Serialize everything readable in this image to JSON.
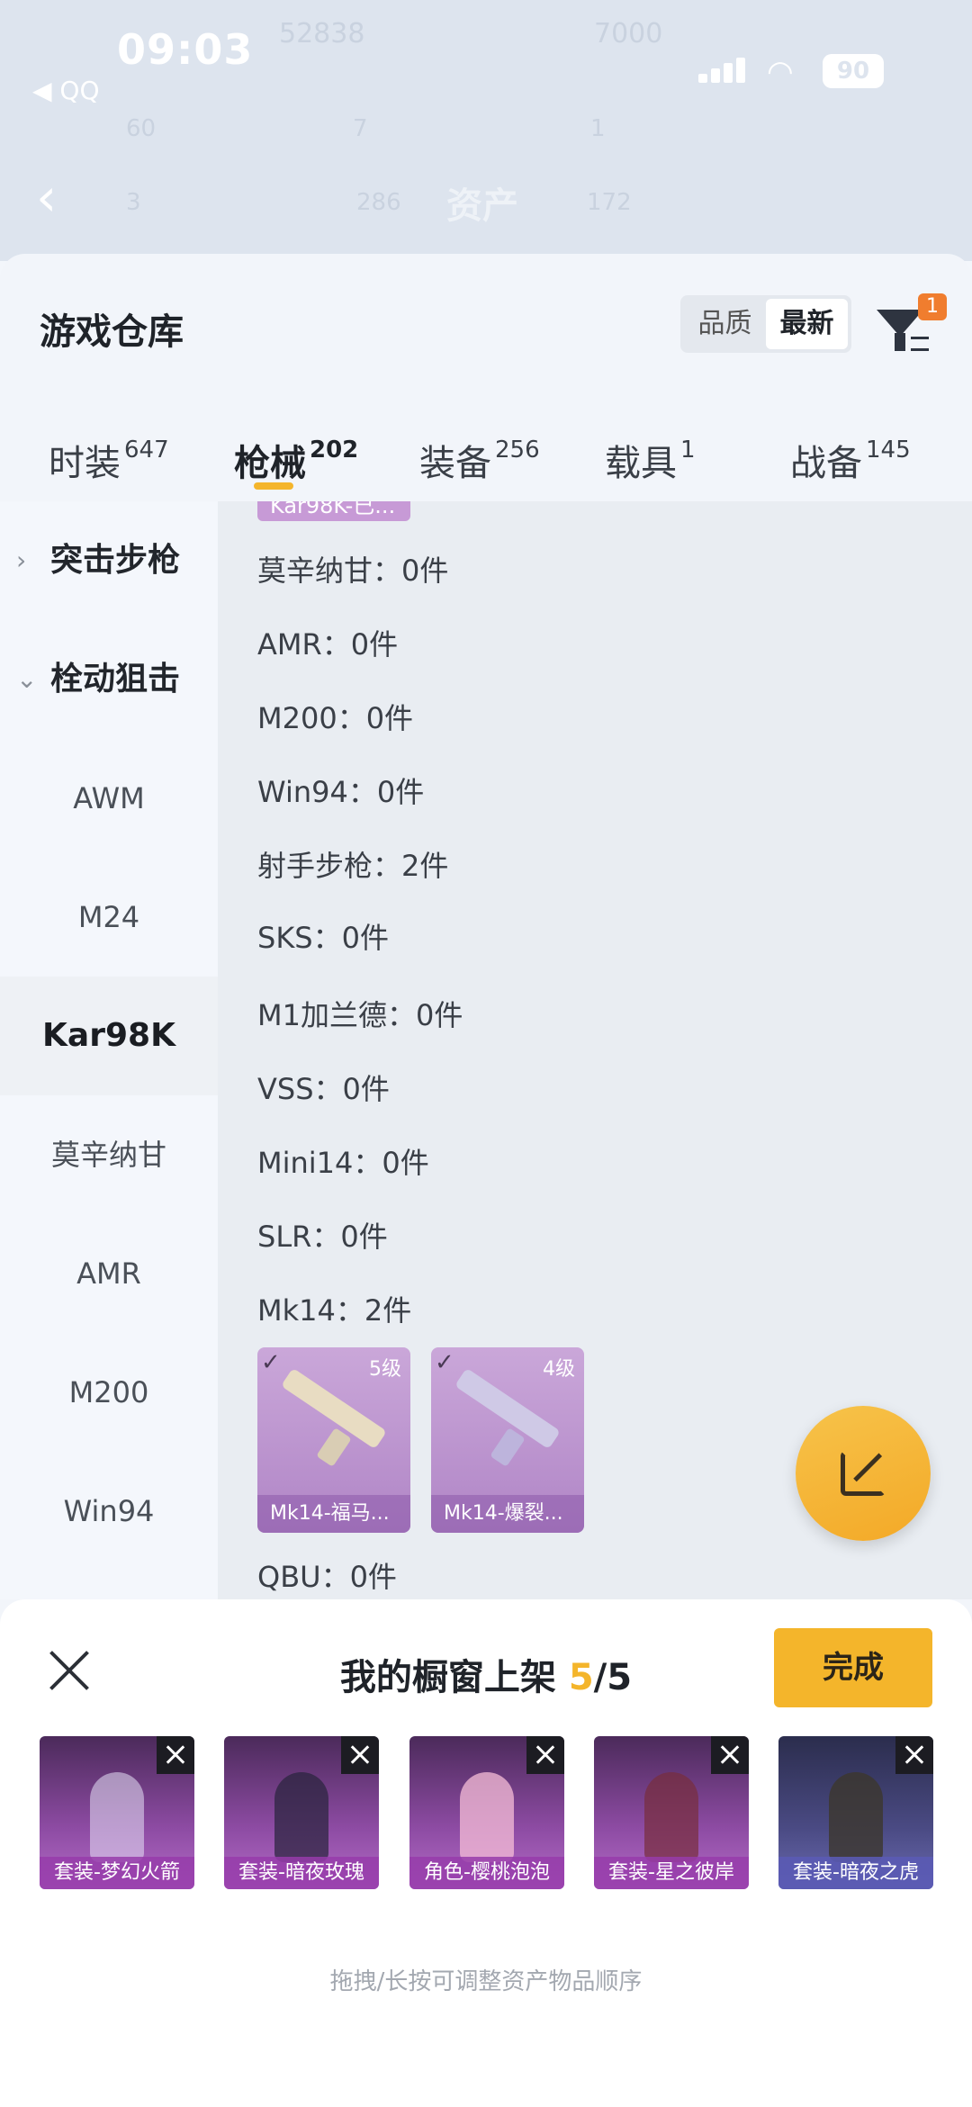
{
  "status_bar": {
    "time": "09:03",
    "back_app": "◀ QQ",
    "battery": "90"
  },
  "background_header": {
    "title": "资产",
    "faded_values": [
      "52838",
      "7000",
      "60",
      "7",
      "1",
      "3",
      "286",
      "172"
    ]
  },
  "sheet": {
    "title": "游戏仓库",
    "sort_options": [
      "品质",
      "最新"
    ],
    "filter_badge": "1"
  },
  "tabs": [
    {
      "label": "时装",
      "count": "647"
    },
    {
      "label": "枪械",
      "count": "202"
    },
    {
      "label": "装备",
      "count": "256"
    },
    {
      "label": "载具",
      "count": "1"
    },
    {
      "label": "战备",
      "count": "145"
    }
  ],
  "sidebar": {
    "groups": [
      {
        "label": "突击步枪",
        "expanded": false
      },
      {
        "label": "栓动狙击",
        "expanded": true
      }
    ],
    "items": [
      "AWM",
      "M24",
      "Kar98K",
      "莫辛纳甘",
      "AMR",
      "M200",
      "Win94"
    ],
    "active": "Kar98K"
  },
  "content": {
    "peek_card": "Kar98K-已...",
    "rows": [
      "莫辛纳甘：0件",
      "AMR：0件",
      "M200：0件",
      "Win94：0件",
      "射手步枪：2件",
      "SKS：0件",
      "M1加兰德：0件",
      "VSS：0件",
      "Mini14：0件",
      "SLR：0件",
      "Mk14：2件"
    ],
    "weapon_cards": [
      {
        "level": "5级",
        "name": "Mk14-福马..."
      },
      {
        "level": "4级",
        "name": "Mk14-爆裂..."
      }
    ],
    "last_row": "QBU：0件"
  },
  "panel": {
    "title_prefix": "我的橱窗上架 ",
    "count": "5",
    "total": "/5",
    "done_label": "完成",
    "items": [
      "套装-梦幻火箭",
      "套装-暗夜玫瑰",
      "角色-樱桃泡泡",
      "套装-星之彼岸",
      "套装-暗夜之虎"
    ],
    "hint": "拖拽/长按可调整资产物品顺序"
  },
  "colors": {
    "accent": "#f4b52b",
    "badge": "#f07d2e",
    "card_purple": "#b085c6"
  }
}
